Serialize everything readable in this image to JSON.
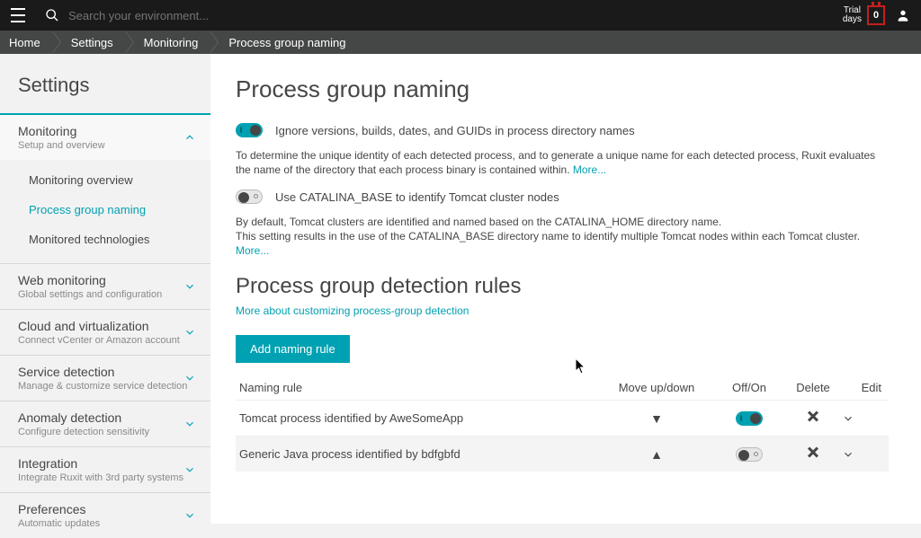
{
  "topbar": {
    "search_placeholder": "Search your environment...",
    "trial_label_line1": "Trial",
    "trial_label_line2": "days",
    "trial_days": "0"
  },
  "breadcrumbs": [
    "Home",
    "Settings",
    "Monitoring",
    "Process group naming"
  ],
  "sidebar": {
    "title": "Settings",
    "sections": [
      {
        "title": "Monitoring",
        "subtitle": "Setup and overview",
        "expanded": true,
        "active": true,
        "items": [
          "Monitoring overview",
          "Process group naming",
          "Monitored technologies"
        ],
        "active_item": 1
      },
      {
        "title": "Web monitoring",
        "subtitle": "Global settings and configuration"
      },
      {
        "title": "Cloud and virtualization",
        "subtitle": "Connect vCenter or Amazon account"
      },
      {
        "title": "Service detection",
        "subtitle": "Manage & customize service detection"
      },
      {
        "title": "Anomaly detection",
        "subtitle": "Configure detection sensitivity"
      },
      {
        "title": "Integration",
        "subtitle": "Integrate Ruxit with 3rd party systems"
      },
      {
        "title": "Preferences",
        "subtitle": "Automatic updates"
      }
    ]
  },
  "main": {
    "title": "Process group naming",
    "toggle1_label": "Ignore versions, builds, dates, and GUIDs in process directory names",
    "desc1": "To determine the unique identity of each detected process, and to generate a unique name for each detected process, Ruxit evaluates the name of the directory that each process binary is contained within.",
    "more": "More...",
    "toggle2_label": "Use CATALINA_BASE to identify Tomcat cluster nodes",
    "desc2_line1": "By default, Tomcat clusters are identified and named based on the CATALINA_HOME directory name.",
    "desc2_line2": "This setting results in the use of the CATALINA_BASE directory name to identify multiple Tomcat nodes within each Tomcat cluster.",
    "subtitle": "Process group detection rules",
    "customize_link": "More about customizing process-group detection",
    "add_button": "Add naming rule",
    "columns": {
      "name": "Naming rule",
      "move": "Move up/down",
      "offon": "Off/On",
      "delete": "Delete",
      "edit": "Edit"
    },
    "rules": [
      {
        "name": "Tomcat process identified by AweSomeApp",
        "direction": "down",
        "on": true
      },
      {
        "name": "Generic Java process identified by bdfgbfd",
        "direction": "up",
        "on": false
      }
    ]
  }
}
